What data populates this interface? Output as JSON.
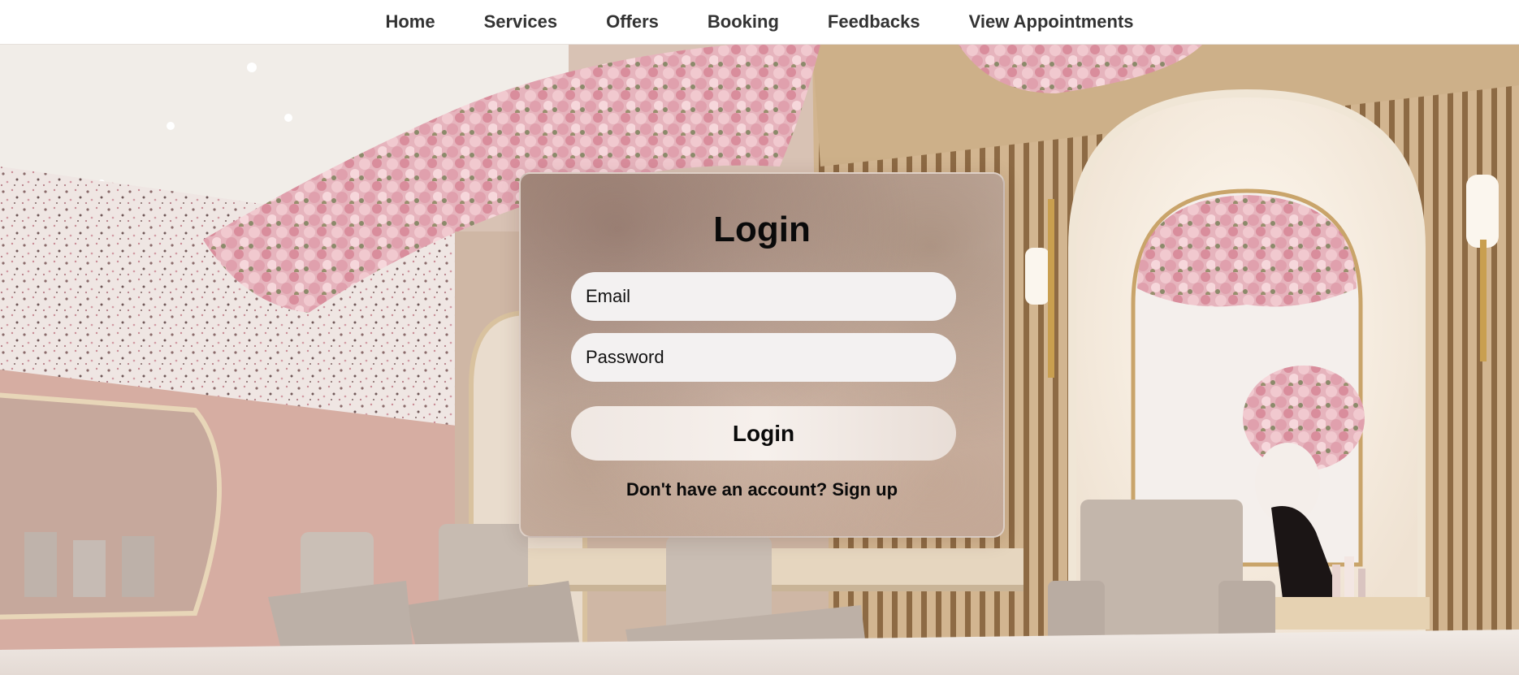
{
  "nav": {
    "items": [
      {
        "label": "Home"
      },
      {
        "label": "Services"
      },
      {
        "label": "Offers"
      },
      {
        "label": "Booking"
      },
      {
        "label": "Feedbacks"
      },
      {
        "label": "View Appointments"
      }
    ]
  },
  "login": {
    "title": "Login",
    "email_placeholder": "Email",
    "password_placeholder": "Password",
    "button_label": "Login",
    "signup_prompt": "Don't have an account?",
    "signup_link": "Sign up"
  },
  "colors": {
    "navbar_bg": "#ffffff",
    "nav_text": "#333333",
    "field_bg": "#f3f1f1",
    "card_tint": "#c8ae9e",
    "wall_pink": "#d6ada2",
    "flower_pink": "#e7a9b5"
  }
}
